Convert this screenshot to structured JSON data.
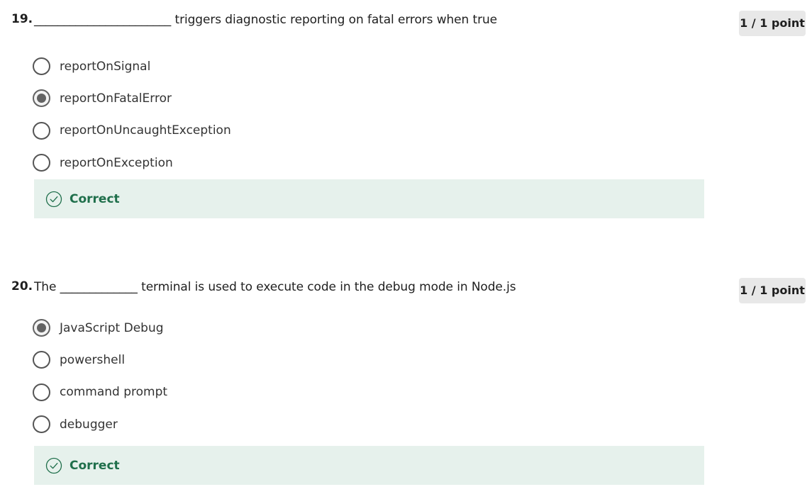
{
  "questions": [
    {
      "number": "19.",
      "text": "_______________________ triggers diagnostic reporting on fatal errors when true",
      "points": "1 / 1 point",
      "options": [
        {
          "label": "reportOnSignal",
          "selected": false
        },
        {
          "label": "reportOnFatalError",
          "selected": true
        },
        {
          "label": "reportOnUncaughtException",
          "selected": false
        },
        {
          "label": "reportOnException",
          "selected": false
        }
      ],
      "feedback": "Correct"
    },
    {
      "number": "20.",
      "text": "The _____________ terminal is used to execute code in the debug mode in Node.js",
      "points": "1 / 1 point",
      "options": [
        {
          "label": "JavaScript Debug",
          "selected": true
        },
        {
          "label": "powershell",
          "selected": false
        },
        {
          "label": "command prompt",
          "selected": false
        },
        {
          "label": "debugger",
          "selected": false
        }
      ],
      "feedback": "Correct"
    }
  ],
  "colors": {
    "feedback_bg": "#e6f1ec",
    "feedback_text": "#1f6f4b",
    "badge_bg": "#e8e8e8",
    "radio_border": "#555555"
  },
  "icons": {
    "correct": "check-circle-icon",
    "radio": "radio-button-icon"
  }
}
